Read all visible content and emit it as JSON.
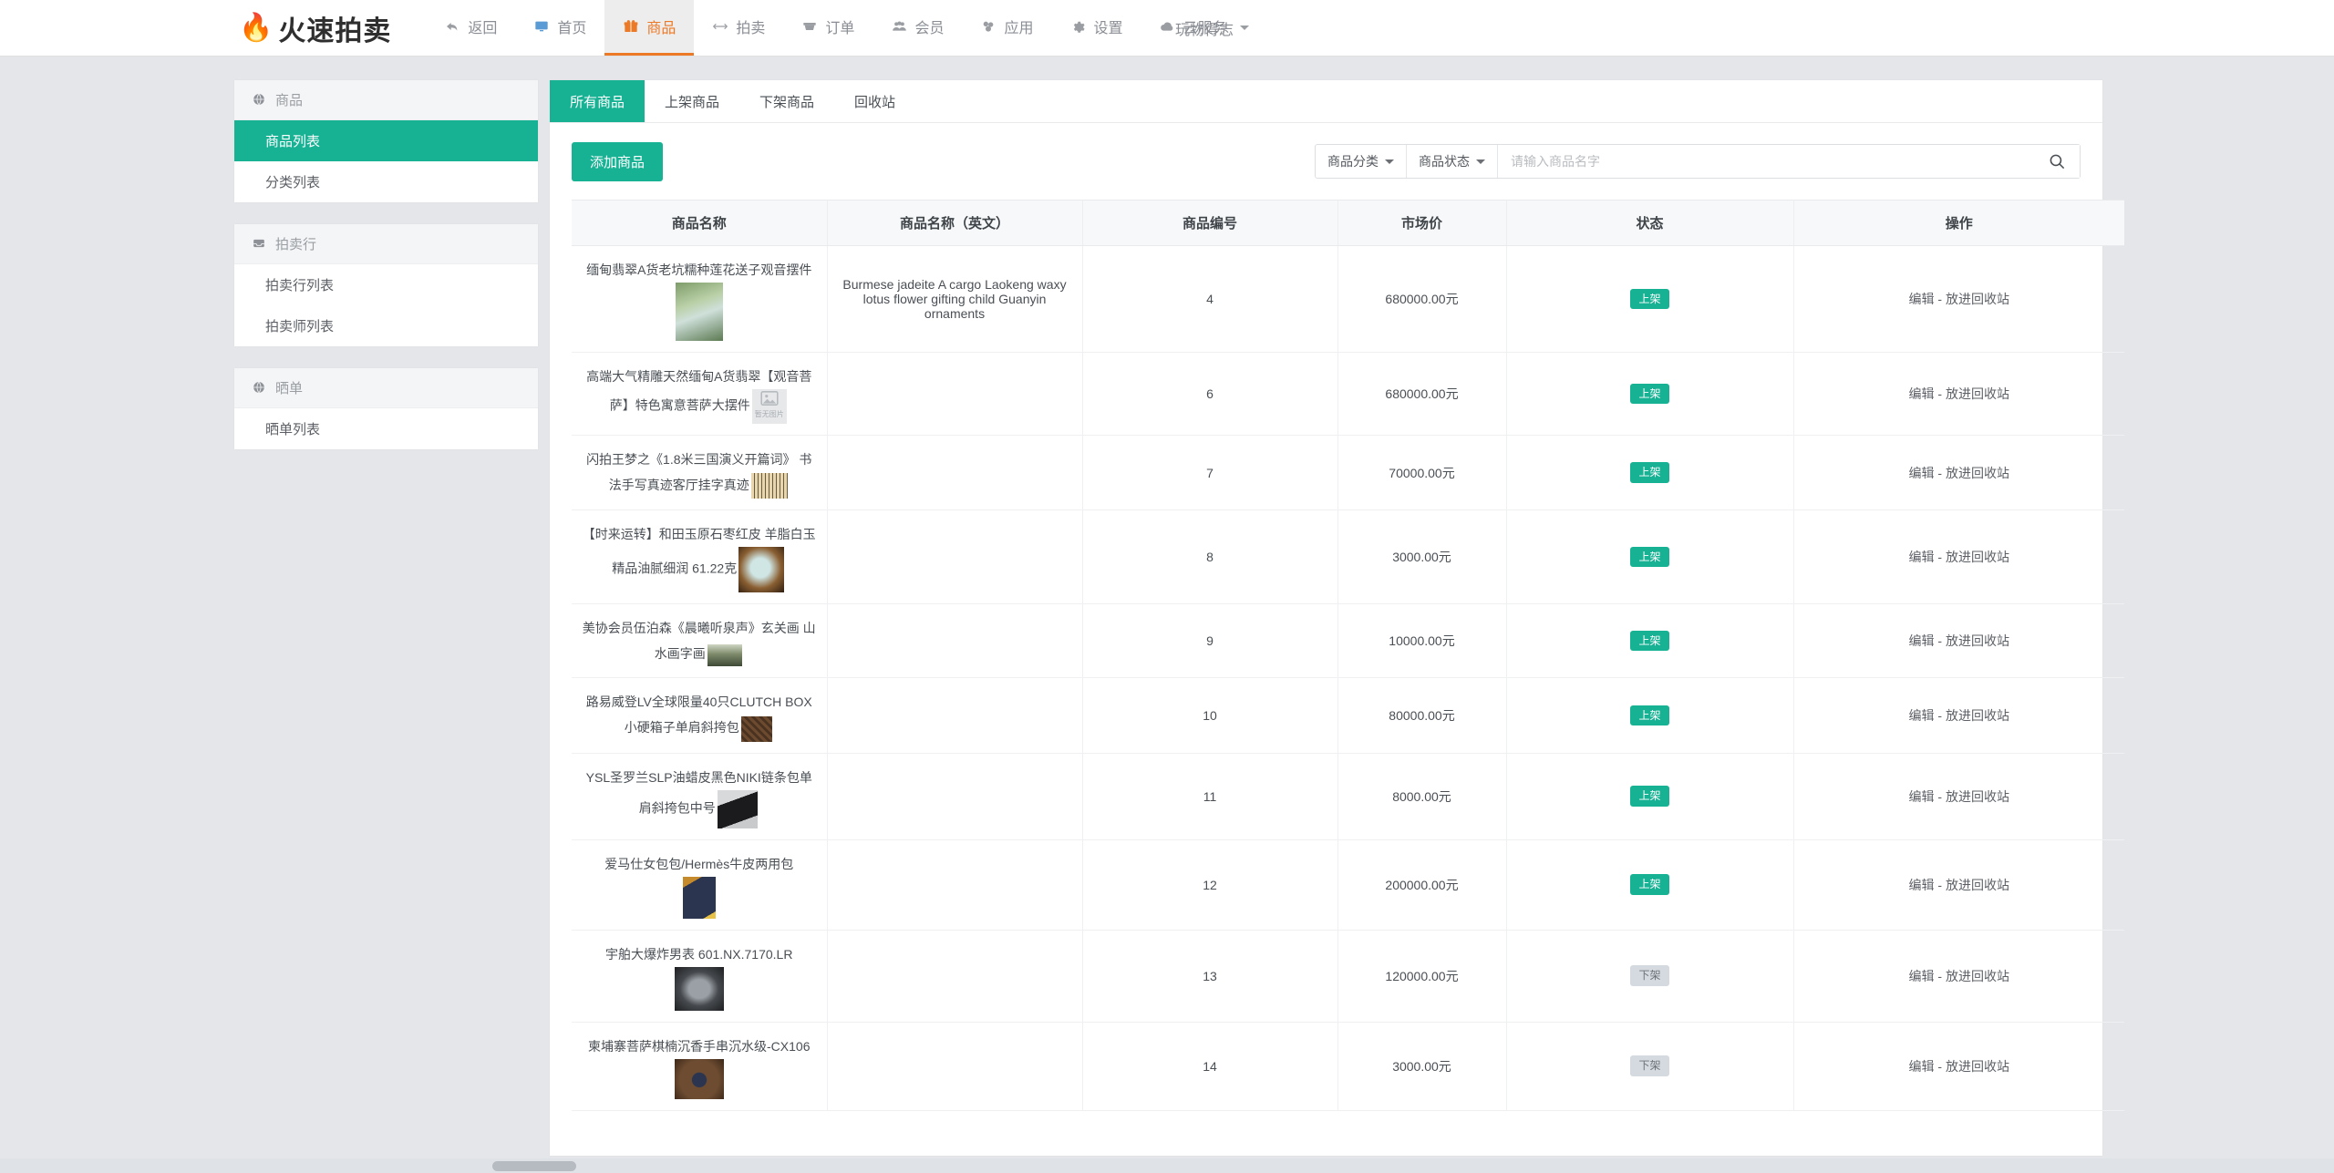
{
  "app": {
    "brand_icon": "flame-icon",
    "brand_title": "火速拍卖",
    "accent_green": "#17b294",
    "accent_orange": "#ec7925"
  },
  "topnav": {
    "items": [
      {
        "label": "返回",
        "icon": "back-arrow-icon",
        "active": false
      },
      {
        "label": "首页",
        "icon": "monitor-icon",
        "active": false
      },
      {
        "label": "商品",
        "icon": "gift-icon",
        "active": true
      },
      {
        "label": "拍卖",
        "icon": "arrows-icon",
        "active": false
      },
      {
        "label": "订单",
        "icon": "cart-icon",
        "active": false
      },
      {
        "label": "会员",
        "icon": "users-icon",
        "active": false
      },
      {
        "label": "应用",
        "icon": "cubes-icon",
        "active": false
      },
      {
        "label": "设置",
        "icon": "gear-icon",
        "active": false
      },
      {
        "label": "云服务",
        "icon": "cloud-icon",
        "active": false
      }
    ],
    "user": "玩物得志"
  },
  "sidebar": {
    "groups": [
      {
        "title": "商品",
        "icon": "globe-icon",
        "links": [
          {
            "label": "商品列表",
            "active": true
          },
          {
            "label": "分类列表",
            "active": false
          }
        ]
      },
      {
        "title": "拍卖行",
        "icon": "inbox-icon",
        "links": [
          {
            "label": "拍卖行列表",
            "active": false
          },
          {
            "label": "拍卖师列表",
            "active": false
          }
        ]
      },
      {
        "title": "晒单",
        "icon": "globe-icon",
        "links": [
          {
            "label": "晒单列表",
            "active": false
          }
        ]
      }
    ]
  },
  "main": {
    "tabs": [
      {
        "label": "所有商品",
        "active": true
      },
      {
        "label": "上架商品",
        "active": false
      },
      {
        "label": "下架商品",
        "active": false
      },
      {
        "label": "回收站",
        "active": false
      }
    ],
    "toolbar": {
      "add_label": "添加商品",
      "category_select": "商品分类",
      "status_select": "商品状态",
      "search_placeholder": "请输入商品名字",
      "search_value": "",
      "search_icon": "search-icon"
    },
    "table": {
      "headers": [
        "商品名称",
        "商品名称（英文）",
        "商品编号",
        "市场价",
        "状态",
        "操作"
      ],
      "ops_label": "编辑 - 放进回收站",
      "rows": [
        {
          "name": "缅甸翡翠A货老坑糯种莲花送子观音摆件",
          "name_en": "Burmese jadeite A cargo Laokeng waxy lotus flower gifting child Guanyin ornaments",
          "id": "4",
          "price": "680000.00元",
          "status": "上架",
          "status_on": true,
          "thumb": "jade-guanyin",
          "thumb_placeholder": false,
          "layout": "block"
        },
        {
          "name": "高端大气精雕天然缅甸A货翡翠【观音菩萨】特色寓意菩萨大摆件",
          "name_en": "",
          "id": "6",
          "price": "680000.00元",
          "status": "上架",
          "status_on": true,
          "thumb": "no-image",
          "thumb_placeholder": true,
          "thumb_placeholder_text": "暂无图片",
          "layout": "inline"
        },
        {
          "name": "闪拍王梦之《1.8米三国演义开篇词》 书法手写真迹客厅挂字真迹",
          "name_en": "",
          "id": "7",
          "price": "70000.00元",
          "status": "上架",
          "status_on": true,
          "thumb": "calligraphy-scroll",
          "thumb_placeholder": false,
          "layout": "inline"
        },
        {
          "name": "【时来运转】和田玉原石枣红皮 羊脂白玉精品油腻细润 61.22克",
          "name_en": "",
          "id": "8",
          "price": "3000.00元",
          "status": "上架",
          "status_on": true,
          "thumb": "hetian-jade",
          "thumb_placeholder": false,
          "layout": "inline"
        },
        {
          "name": "美协会员伍泊森《晨曦听泉声》玄关画 山水画字画",
          "name_en": "",
          "id": "9",
          "price": "10000.00元",
          "status": "上架",
          "status_on": true,
          "thumb": "landscape-painting",
          "thumb_placeholder": false,
          "layout": "inline"
        },
        {
          "name": "路易威登LV全球限量40只CLUTCH BOX小硬箱子单肩斜挎包",
          "name_en": "",
          "id": "10",
          "price": "80000.00元",
          "status": "上架",
          "status_on": true,
          "thumb": "lv-clutch-box",
          "thumb_placeholder": false,
          "layout": "inline"
        },
        {
          "name": "YSL圣罗兰SLP油蜡皮黑色NIKI链条包单肩斜挎包中号",
          "name_en": "",
          "id": "11",
          "price": "8000.00元",
          "status": "上架",
          "status_on": true,
          "thumb": "ysl-niki-bag",
          "thumb_placeholder": false,
          "layout": "inline"
        },
        {
          "name": "爱马仕女包包/Hermès牛皮两用包",
          "name_en": "",
          "id": "12",
          "price": "200000.00元",
          "status": "上架",
          "status_on": true,
          "thumb": "hermes-bag",
          "thumb_placeholder": false,
          "layout": "block"
        },
        {
          "name": "宇舶大爆炸男表 601.NX.7170.LR",
          "name_en": "",
          "id": "13",
          "price": "120000.00元",
          "status": "下架",
          "status_on": false,
          "thumb": "hublot-watch",
          "thumb_placeholder": false,
          "layout": "block"
        },
        {
          "name": "柬埔寨菩萨棋楠沉香手串沉水级-CX106",
          "name_en": "",
          "id": "14",
          "price": "3000.00元",
          "status": "下架",
          "status_on": false,
          "thumb": "agarwood-bracelet",
          "thumb_placeholder": false,
          "layout": "block"
        }
      ]
    }
  }
}
